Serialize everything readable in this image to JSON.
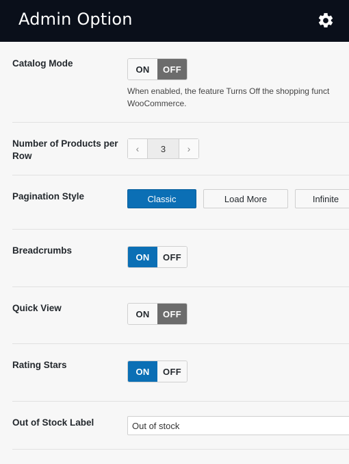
{
  "header": {
    "title": "Admin Option",
    "settings_icon": "gear-icon"
  },
  "settings": {
    "catalog_mode": {
      "label": "Catalog Mode",
      "on": "ON",
      "off": "OFF",
      "state": "off",
      "description_line1": "When enabled, the feature Turns Off the shopping funct",
      "description_line2": "WooCommerce."
    },
    "products_per_row": {
      "label_line1": "Number of Products per",
      "label_line2": "Row",
      "value": "3",
      "prev_icon": "chevron-left-icon",
      "next_icon": "chevron-right-icon"
    },
    "pagination_style": {
      "label": "Pagination Style",
      "options": [
        "Classic",
        "Load More",
        "Infinite"
      ],
      "selected": "Classic"
    },
    "breadcrumbs": {
      "label": "Breadcrumbs",
      "on": "ON",
      "off": "OFF",
      "state": "on"
    },
    "quick_view": {
      "label": "Quick View",
      "on": "ON",
      "off": "OFF",
      "state": "off"
    },
    "rating_stars": {
      "label": "Rating Stars",
      "on": "ON",
      "off": "OFF",
      "state": "on"
    },
    "out_of_stock_label": {
      "label": "Out of Stock Label",
      "value": "Out of stock"
    }
  },
  "colors": {
    "header_bg": "#0a0f1a",
    "accent": "#0b6fb5",
    "off_active": "#6c6c6c"
  }
}
